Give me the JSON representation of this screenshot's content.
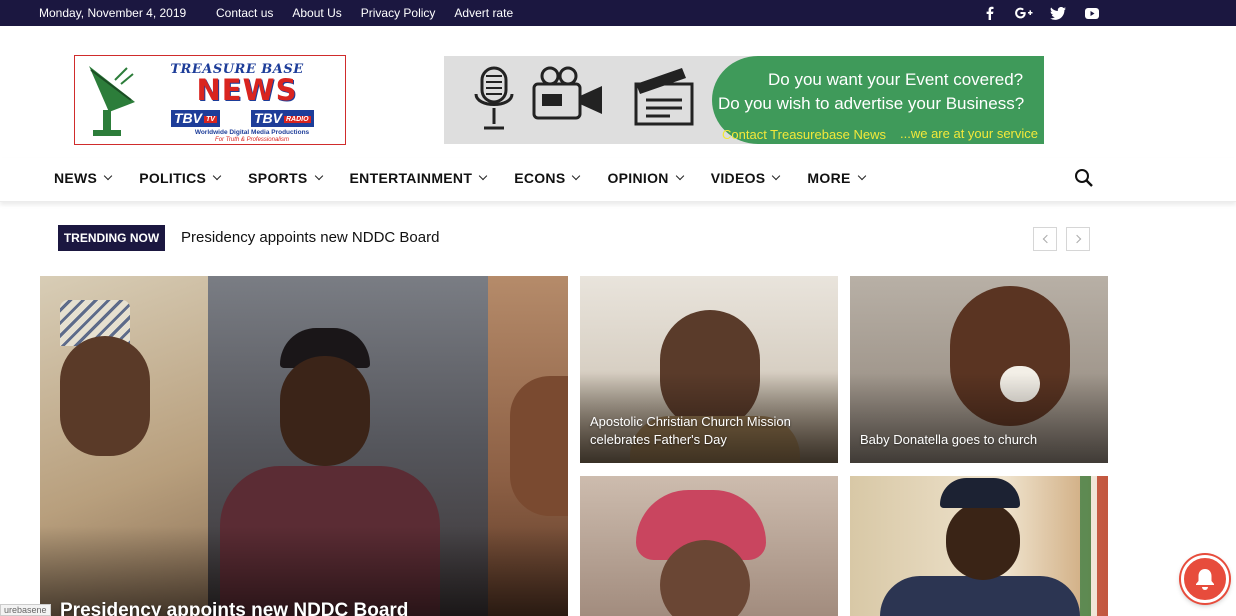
{
  "topbar": {
    "date": "Monday, November 4, 2019",
    "links": [
      "Contact us",
      "About Us",
      "Privacy Policy",
      "Advert rate"
    ],
    "social_icons": [
      "facebook-icon",
      "google-plus-icon",
      "twitter-icon",
      "youtube-icon"
    ],
    "background": "#1b1740"
  },
  "logo": {
    "line1": "TREASURE BASE",
    "line2": "NEWS",
    "tv": "TBV",
    "tv_tag": "TV",
    "radio": "TBV",
    "radio_tag": "RADIO",
    "tagline": "Worldwide Digital Media Productions",
    "motto": "For Truth & Professionalism"
  },
  "banner": {
    "line1": "Do you want your Event covered?",
    "line2": "Do you wish to advertise your Business?",
    "line3": "Contact Treasurebase News",
    "line4": "...we are at your service",
    "accent": "#3f9a5a"
  },
  "nav": {
    "items": [
      "NEWS",
      "POLITICS",
      "SPORTS",
      "ENTERTAINMENT",
      "ECONS",
      "OPINION",
      "VIDEOS",
      "MORE"
    ]
  },
  "trending": {
    "badge": "TRENDING NOW",
    "headline": "Presidency appoints new NDDC Board"
  },
  "tiles": {
    "main": "Presidency appoints new NDDC Board",
    "t1": "Apostolic Christian Church Mission celebrates Father's Day",
    "t2": "Baby Donatella goes to church"
  },
  "status_url": "urebasene"
}
